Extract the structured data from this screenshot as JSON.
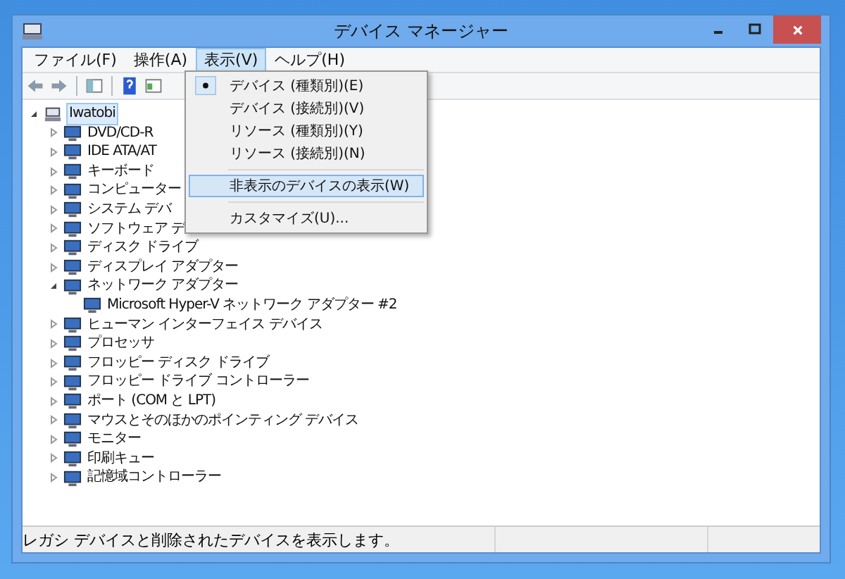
{
  "window": {
    "title": "デバイス マネージャー"
  },
  "menu_bar": [
    {
      "label": "ファイル(F)",
      "selected": false
    },
    {
      "label": "操作(A)",
      "selected": false
    },
    {
      "label": "表示(V)",
      "selected": true
    },
    {
      "label": "ヘルプ(H)",
      "selected": false
    }
  ],
  "view_menu": {
    "groups": [
      {
        "items": [
          {
            "label": "デバイス (種類別)(E)",
            "checked": true,
            "highlighted": false
          },
          {
            "label": "デバイス (接続別)(V)",
            "checked": false,
            "highlighted": false
          },
          {
            "label": "リソース (種類別)(Y)",
            "checked": false,
            "highlighted": false
          },
          {
            "label": "リソース (接続別)(N)",
            "checked": false,
            "highlighted": false
          }
        ]
      },
      {
        "items": [
          {
            "label": "非表示のデバイスの表示(W)",
            "checked": false,
            "highlighted": true
          }
        ]
      },
      {
        "items": [
          {
            "label": "カスタマイズ(U)...",
            "checked": false,
            "highlighted": false
          }
        ]
      }
    ]
  },
  "tree": {
    "label": "Iwatobi",
    "expanded": true,
    "selected": true,
    "children": [
      {
        "label": "DVD/CD-R",
        "expanded": false
      },
      {
        "label": "IDE ATA/AT",
        "expanded": false
      },
      {
        "label": "キーボード",
        "expanded": false
      },
      {
        "label": "コンピューター",
        "expanded": false
      },
      {
        "label": "システム デバ",
        "expanded": false
      },
      {
        "label": "ソフトウェア デ",
        "expanded": false
      },
      {
        "label": "ディスク ドライブ",
        "expanded": false
      },
      {
        "label": "ディスプレイ アダプター",
        "expanded": false
      },
      {
        "label": "ネットワーク アダプター",
        "expanded": true,
        "children": [
          {
            "label": "Microsoft Hyper-V ネットワーク アダプター #2"
          }
        ]
      },
      {
        "label": "ヒューマン インターフェイス デバイス",
        "expanded": false
      },
      {
        "label": "プロセッサ",
        "expanded": false
      },
      {
        "label": "フロッピー ディスク ドライブ",
        "expanded": false
      },
      {
        "label": "フロッピー ドライブ コントローラー",
        "expanded": false
      },
      {
        "label": "ポート (COM と LPT)",
        "expanded": false
      },
      {
        "label": "マウスとそのほかのポインティング デバイス",
        "expanded": false
      },
      {
        "label": "モニター",
        "expanded": false
      },
      {
        "label": "印刷キュー",
        "expanded": false
      },
      {
        "label": "記憶域コントローラー",
        "expanded": false
      }
    ]
  },
  "status_bar": {
    "text": "レガシ デバイスと削除されたデバイスを表示します。"
  }
}
